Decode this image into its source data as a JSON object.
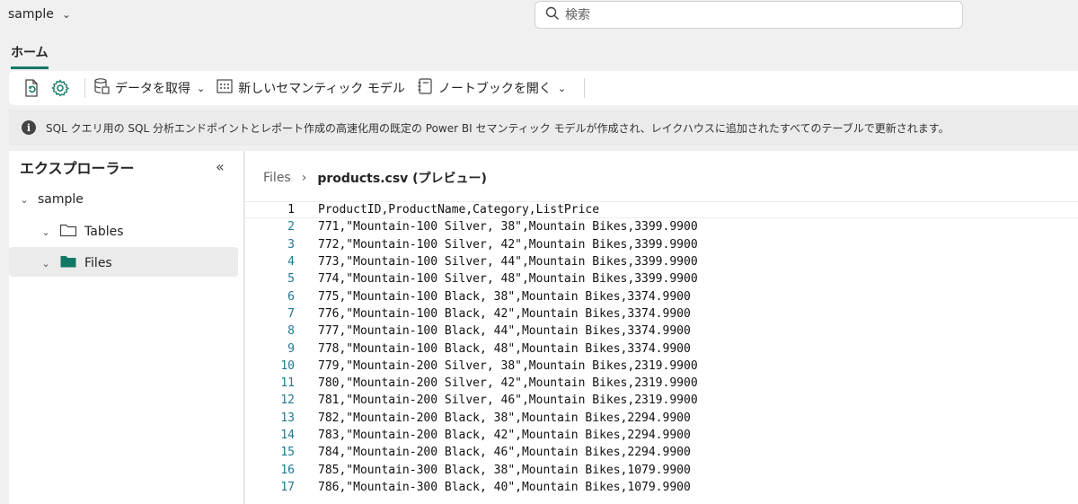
{
  "topbar": {
    "workspace": "sample",
    "search_placeholder": "検索"
  },
  "tabs": [
    {
      "label": "ホーム"
    }
  ],
  "ribbon": {
    "get_data": "データを取得",
    "new_semantic_model": "新しいセマンティック モデル",
    "open_notebook": "ノートブックを開く"
  },
  "info": {
    "message": "SQL クエリ用の SQL 分析エンドポイントとレポート作成の高速化用の既定の Power BI セマンティック モデルが作成され、レイクハウスに追加されたすべてのテーブルで更新されます。"
  },
  "explorer": {
    "title": "エクスプローラー",
    "root": "sample",
    "items": [
      {
        "label": "Tables"
      },
      {
        "label": "Files"
      }
    ]
  },
  "breadcrumb": {
    "parent": "Files",
    "current": "products.csv (プレビュー)"
  },
  "preview": {
    "lines": [
      {
        "n": "1",
        "t": "ProductID,ProductName,Category,ListPrice"
      },
      {
        "n": "2",
        "t": "771,\"Mountain-100 Silver, 38\",Mountain Bikes,3399.9900"
      },
      {
        "n": "3",
        "t": "772,\"Mountain-100 Silver, 42\",Mountain Bikes,3399.9900"
      },
      {
        "n": "4",
        "t": "773,\"Mountain-100 Silver, 44\",Mountain Bikes,3399.9900"
      },
      {
        "n": "5",
        "t": "774,\"Mountain-100 Silver, 48\",Mountain Bikes,3399.9900"
      },
      {
        "n": "6",
        "t": "775,\"Mountain-100 Black, 38\",Mountain Bikes,3374.9900"
      },
      {
        "n": "7",
        "t": "776,\"Mountain-100 Black, 42\",Mountain Bikes,3374.9900"
      },
      {
        "n": "8",
        "t": "777,\"Mountain-100 Black, 44\",Mountain Bikes,3374.9900"
      },
      {
        "n": "9",
        "t": "778,\"Mountain-100 Black, 48\",Mountain Bikes,3374.9900"
      },
      {
        "n": "10",
        "t": "779,\"Mountain-200 Silver, 38\",Mountain Bikes,2319.9900"
      },
      {
        "n": "11",
        "t": "780,\"Mountain-200 Silver, 42\",Mountain Bikes,2319.9900"
      },
      {
        "n": "12",
        "t": "781,\"Mountain-200 Silver, 46\",Mountain Bikes,2319.9900"
      },
      {
        "n": "13",
        "t": "782,\"Mountain-200 Black, 38\",Mountain Bikes,2294.9900"
      },
      {
        "n": "14",
        "t": "783,\"Mountain-200 Black, 42\",Mountain Bikes,2294.9900"
      },
      {
        "n": "15",
        "t": "784,\"Mountain-200 Black, 46\",Mountain Bikes,2294.9900"
      },
      {
        "n": "16",
        "t": "785,\"Mountain-300 Black, 38\",Mountain Bikes,1079.9900"
      },
      {
        "n": "17",
        "t": "786,\"Mountain-300 Black, 40\",Mountain Bikes,1079.9900"
      }
    ]
  },
  "colors": {
    "accent": "#117865",
    "folder_fill": "#117865",
    "line_number": "#237893"
  }
}
